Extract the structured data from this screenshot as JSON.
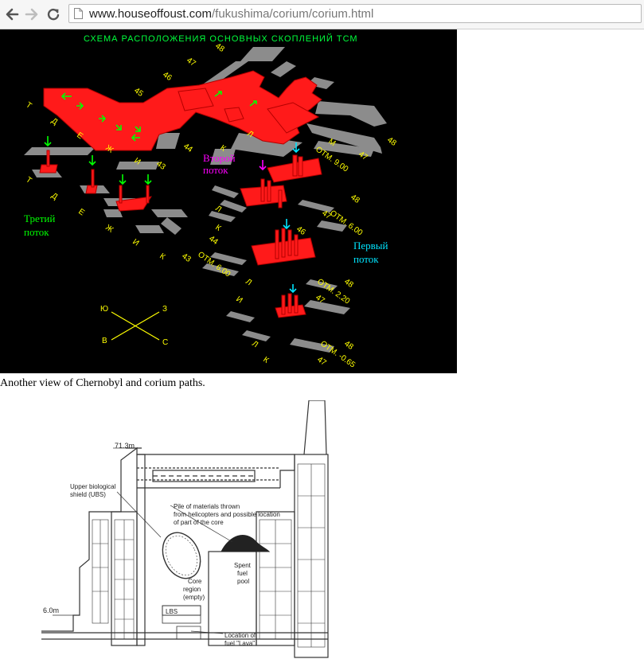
{
  "browser": {
    "url_host": "www.houseoffoust.com",
    "url_path": "/fukushima/corium/corium.html",
    "back_icon": "back-arrow-icon",
    "forward_icon": "forward-arrow-icon",
    "reload_icon": "reload-icon",
    "page_icon": "page-icon"
  },
  "figure1": {
    "title": "СХЕМА РАСПОЛОЖЕНИЯ ОСНОВНЫХ СКОПЛЕНИЙ ТСМ",
    "flow_second": [
      "Второй",
      "поток"
    ],
    "flow_third": [
      "Третий",
      "поток"
    ],
    "flow_first": [
      "Первый",
      "поток"
    ],
    "elevations": [
      "ОТМ. 9.00",
      "ОТМ. 6.00",
      "ОТМ. 6.00",
      "ОТМ. 2.20",
      "ОТМ. -0.65"
    ],
    "axis_numbers": [
      "48",
      "47",
      "46",
      "45",
      "44",
      "43",
      "48",
      "47",
      "48",
      "47",
      "44",
      "43",
      "46",
      "48",
      "47",
      "48",
      "47"
    ],
    "row_letters_upper": [
      "Т",
      "Д",
      "Е",
      "Ж",
      "И"
    ],
    "row_letters_lower": [
      "Т",
      "Д",
      "Е",
      "Ж",
      "И",
      "К"
    ],
    "row_letters_mid": [
      "К",
      "Л",
      "М",
      "Л",
      "К",
      "Л",
      "И",
      "Л",
      "К"
    ],
    "compass": [
      "Ю",
      "З",
      "В",
      "С"
    ],
    "colors": {
      "title": "#00ff3c",
      "labels": "#ffff00",
      "corium": "#ff1a1a",
      "second": "#ff00ff",
      "third": "#00ff00",
      "first": "#00e5ff"
    }
  },
  "caption": "Another view of Chernobyl and corium paths.",
  "figure2": {
    "elev_top": "71.3m",
    "elev_bottom": "6.0m",
    "ubs_label": [
      "Upper biological",
      "shield (UBS)"
    ],
    "pile_label": [
      "Pile of materials thrown",
      "from helicopters and possible location",
      "of part of the core"
    ],
    "core_label": [
      "Core",
      "region",
      "(empty)"
    ],
    "spent_fuel_label": [
      "Spent",
      "fuel",
      "pool"
    ],
    "lbs_label": "LBS",
    "lava_label": [
      "Location of",
      "fuel \"Lava\""
    ]
  }
}
